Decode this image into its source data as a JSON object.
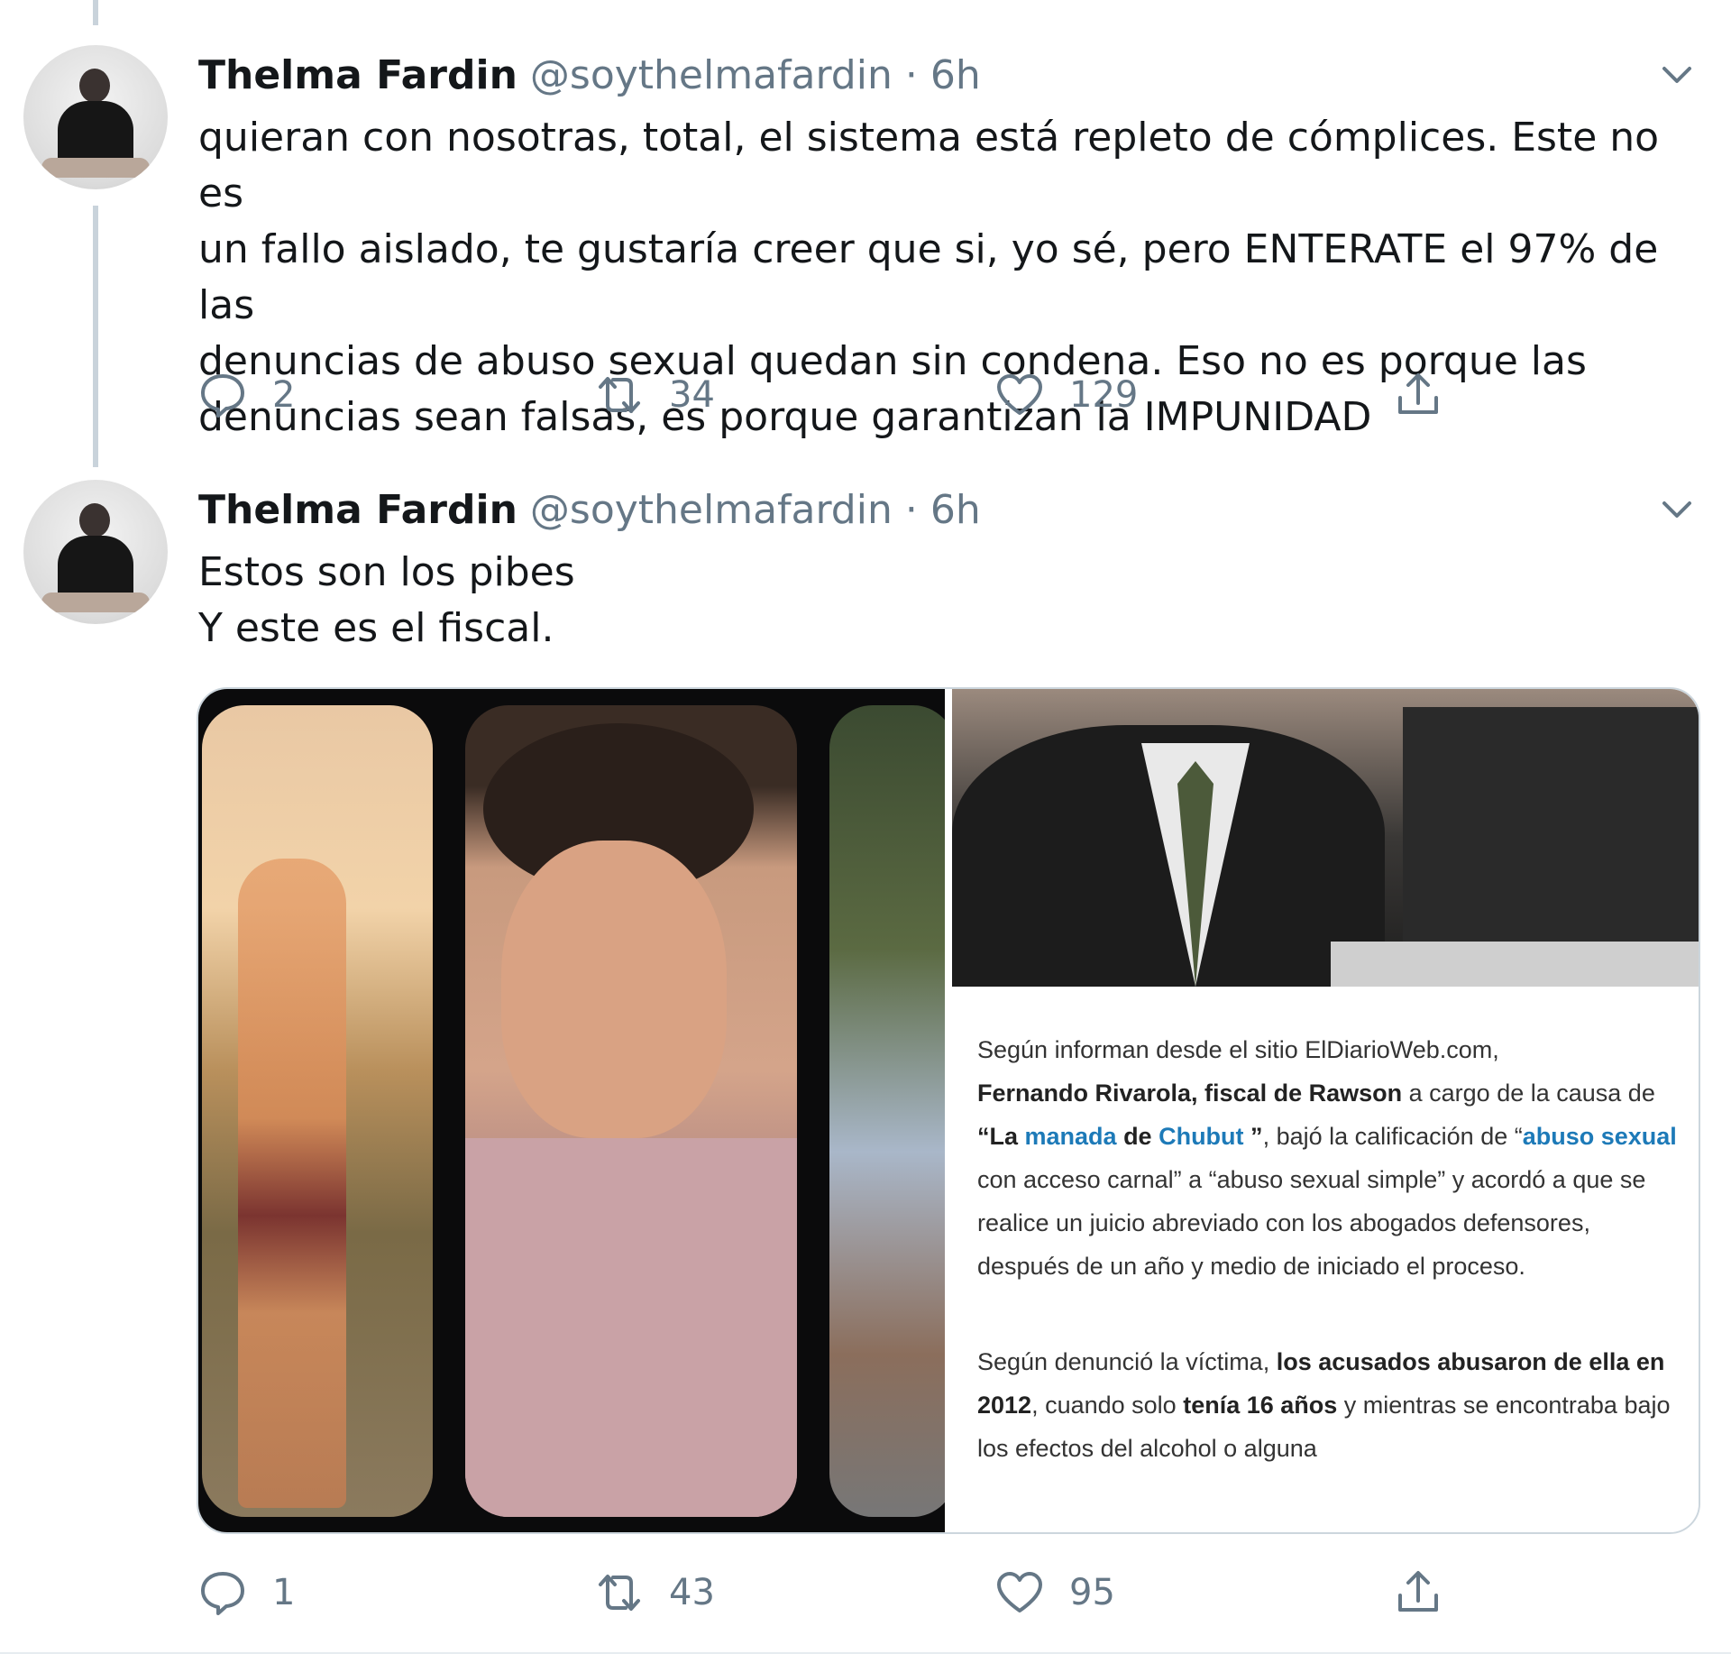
{
  "tweets": [
    {
      "name": "Thelma Fardin",
      "handle": "@soythelmafardin",
      "separator": "·",
      "time": "6h",
      "text_lines": [
        "quieran con nosotras, total, el sistema está repleto de cómplices. Este no es",
        "un fallo aislado, te gustaría creer que si, yo sé, pero ENTERATE el 97% de las",
        "denuncias de abuso sexual quedan sin condena. Eso no es porque las",
        "denuncias sean falsas, es porque garantizan la IMPUNIDAD"
      ],
      "replies": "2",
      "retweets": "34",
      "likes": "129"
    },
    {
      "name": "Thelma Fardin",
      "handle": "@soythelmafardin",
      "separator": "·",
      "time": "6h",
      "text_lines": [
        "Estos son los pibes",
        "Y este es el fiscal."
      ],
      "replies": "1",
      "retweets": "43",
      "likes": "95",
      "media_article": {
        "p1_a": "Según informan desde el sitio ElDiarioWeb.com,",
        "p1_b_bold": "Fernando Rivarola, fiscal de Rawson",
        "p1_c": " a cargo de la causa de ",
        "p1_d_bold": "“La ",
        "p1_e_link": "manada",
        "p1_f_bold": " de ",
        "p1_g_link": "Chubut",
        "p1_h_bold": " ”",
        "p1_i": ", bajó la calificación de “",
        "p1_j_link": "abuso sexual",
        "p1_k": " con acceso carnal” a “abuso sexual simple” y acordó a que se realice un juicio abreviado con los abogados defensores, después de un año y medio de iniciado el proceso.",
        "p2_a": "Según denunció la víctima, ",
        "p2_b_bold": "los acusados abusaron de ella en 2012",
        "p2_c": ", cuando solo ",
        "p2_d_bold": "tenía 16 años",
        "p2_e": " y mientras se encontraba bajo los efectos del alcohol o alguna"
      }
    }
  ],
  "icons": {
    "reply": "reply-bubble-icon",
    "retweet": "retweet-icon",
    "like": "heart-icon",
    "share": "share-icon",
    "menu": "chevron-down-icon"
  },
  "colors": {
    "text": "#14171a",
    "muted": "#657786",
    "thread_line": "#c9d3db",
    "link": "#1d7ab8"
  }
}
